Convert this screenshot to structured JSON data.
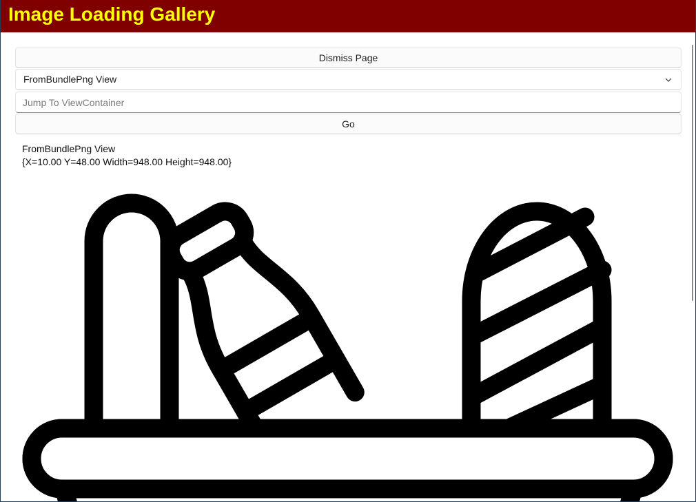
{
  "window": {
    "title": "Image Loading Gallery",
    "title_bar_color": "#800000",
    "title_text_color": "#ffff00"
  },
  "controls": {
    "dismiss_label": "Dismiss Page",
    "view_select": {
      "selected": "FromBundlePng View",
      "icon": "chevron-down-icon"
    },
    "jump_input": {
      "placeholder": "Jump To ViewContainer",
      "value": ""
    },
    "go_label": "Go"
  },
  "view_info": {
    "name": "FromBundlePng View",
    "bounds": "{X=10.00 Y=48.00 Width=948.00 Height=948.00}"
  },
  "image": {
    "icon": "grocery-basket-icon"
  }
}
